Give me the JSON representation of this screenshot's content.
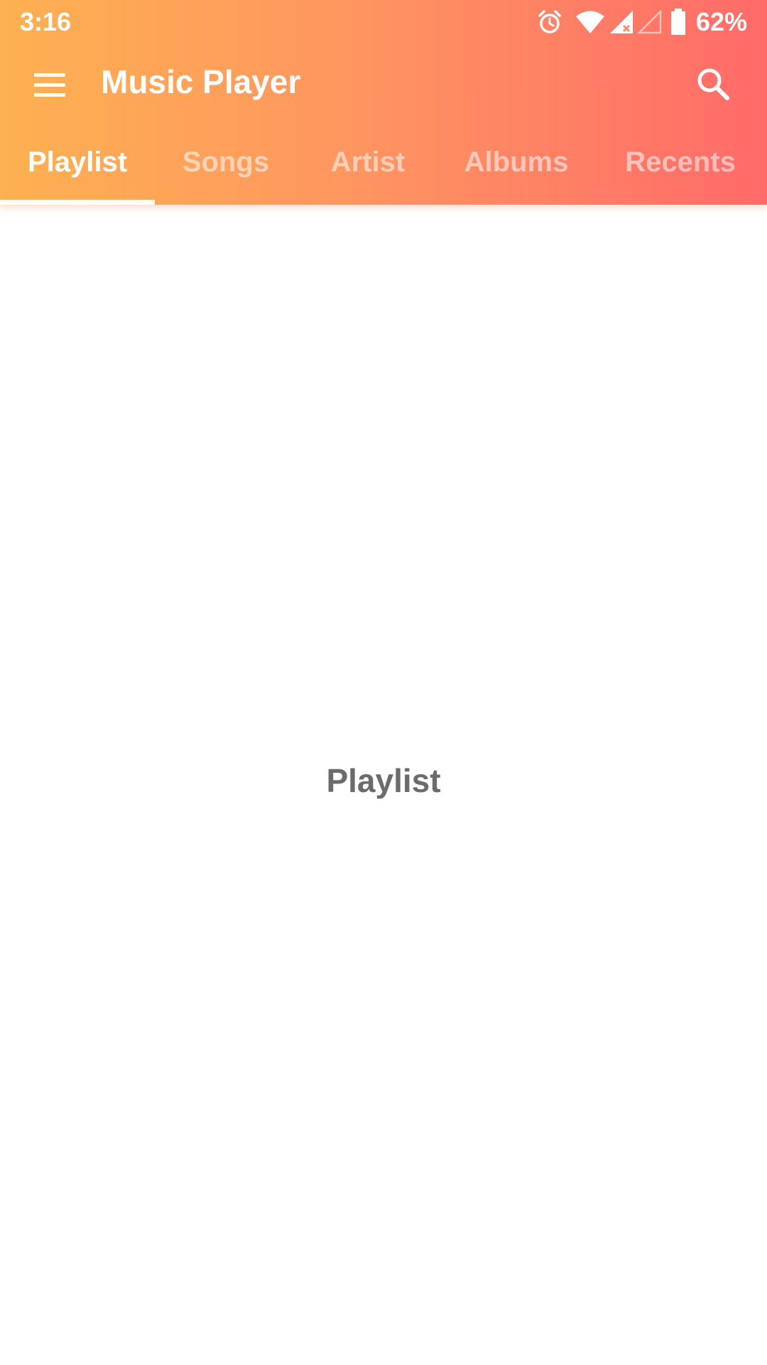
{
  "status_bar": {
    "time": "3:16",
    "battery_percent": "62%",
    "icons": [
      "alarm-icon",
      "wifi-icon",
      "signal-icon",
      "signal-empty-icon",
      "battery-icon"
    ]
  },
  "toolbar": {
    "menu_icon": "menu-icon",
    "title": "Music Player",
    "search_icon": "search-icon"
  },
  "tabs": [
    {
      "label": "Playlist",
      "active": true
    },
    {
      "label": "Songs",
      "active": false
    },
    {
      "label": "Artist",
      "active": false
    },
    {
      "label": "Albums",
      "active": false
    },
    {
      "label": "Recents",
      "active": false
    }
  ],
  "content": {
    "placeholder": "Playlist"
  },
  "colors": {
    "gradient_start": "#FDB151",
    "gradient_end": "#FF6B69",
    "placeholder_text": "#6B6B6B"
  }
}
